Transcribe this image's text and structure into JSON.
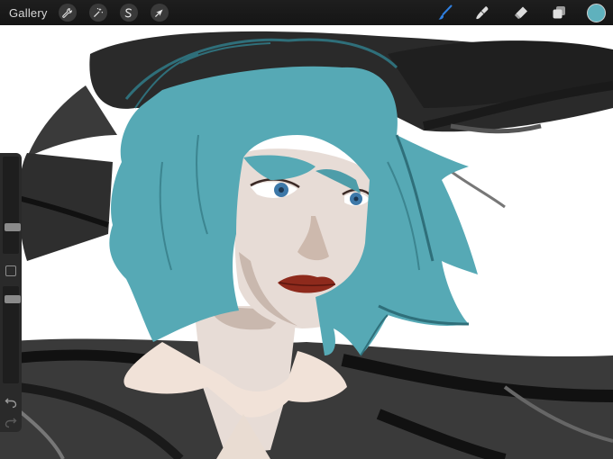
{
  "topbar": {
    "gallery_label": "Gallery",
    "left_tools": [
      {
        "name": "adjustments",
        "icon": "wrench-icon"
      },
      {
        "name": "actions",
        "icon": "magic-wand-icon"
      },
      {
        "name": "selection",
        "icon": "selection-s-icon"
      },
      {
        "name": "transform",
        "icon": "arrow-cursor-icon"
      }
    ],
    "right_tools": [
      {
        "name": "brush",
        "icon": "brush-icon",
        "active": true
      },
      {
        "name": "smudge",
        "icon": "smudge-icon"
      },
      {
        "name": "eraser",
        "icon": "eraser-icon"
      },
      {
        "name": "layers",
        "icon": "layers-icon"
      }
    ],
    "current_color": "#5fb1bd",
    "accent_color": "#2f7fe0"
  },
  "sidebar": {
    "brush_size_level": 0.25,
    "opacity_level": 0.9,
    "undo_icon": "undo-icon",
    "redo_icon": "redo-icon"
  },
  "colors": {
    "hair": "#56a9b5",
    "hair_dark": "#2f6f7a",
    "skin": "#e7dcd6",
    "skin_shadow": "#c9b8ae",
    "lips": "#8e2a1c",
    "hat": "#2b2b2b",
    "collar": "#f1e2d8"
  }
}
